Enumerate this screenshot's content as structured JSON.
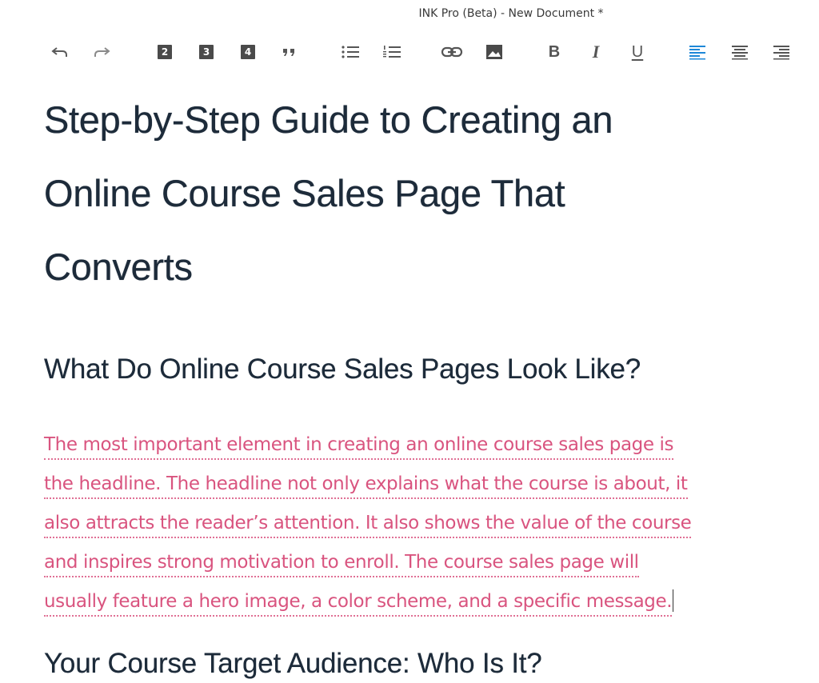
{
  "window": {
    "title": "INK Pro (Beta) - New Document *"
  },
  "toolbar": {
    "items": [
      {
        "name": "undo-icon",
        "glyph": "↶"
      },
      {
        "name": "redo-icon",
        "glyph": "↷"
      },
      {
        "name": "heading-2-icon",
        "label": "2"
      },
      {
        "name": "heading-3-icon",
        "label": "3"
      },
      {
        "name": "heading-4-icon",
        "label": "4"
      },
      {
        "name": "blockquote-icon",
        "glyph": "”"
      },
      {
        "name": "bullet-list-icon"
      },
      {
        "name": "numbered-list-icon"
      },
      {
        "name": "link-icon"
      },
      {
        "name": "image-icon"
      },
      {
        "name": "bold-icon",
        "label": "B"
      },
      {
        "name": "italic-icon",
        "label": "I"
      },
      {
        "name": "underline-icon",
        "label": "U"
      },
      {
        "name": "align-left-icon",
        "active": true
      },
      {
        "name": "align-center-icon"
      },
      {
        "name": "align-right-icon"
      }
    ],
    "active_color": "#1e88d8",
    "icon_color": "#555555"
  },
  "document": {
    "title": "Step-by-Step Guide to Creating an Online Course Sales Page That Converts",
    "title_lines": [
      "Step-by-Step Guide to Creating an",
      "Online Course Sales Page That",
      "Converts"
    ],
    "section1_heading": "What Do Online Course Sales Pages Look Like?",
    "section1_paragraph_lines": [
      "The most important element in creating an online course sales page is",
      "the headline. The headline not only explains what the course is about, it",
      "also attracts the reader’s attention. It also shows the value of the course",
      "and inspires strong motivation to enroll. The course sales page will",
      "usually feature a hero image, a color scheme, and a specific message."
    ],
    "section2_heading": "Your Course Target Audience: Who Is It?",
    "paragraph_color": "#d9547f",
    "heading_color": "#1d2b3a"
  }
}
